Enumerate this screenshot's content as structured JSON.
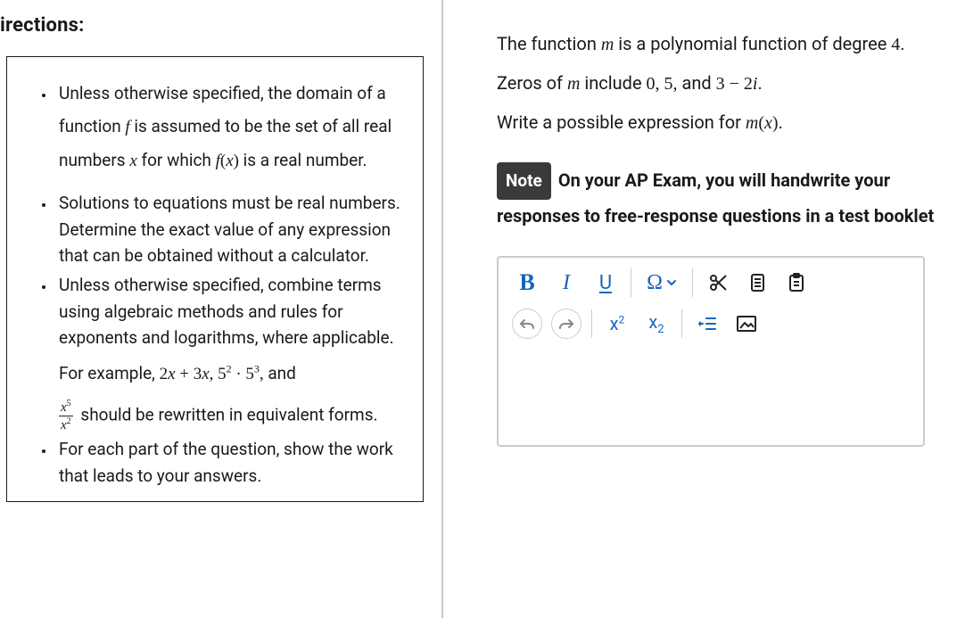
{
  "left": {
    "heading": "irections:",
    "bullets": [
      "Unless otherwise specified, the domain of a function  f  is assumed to be the set of all real numbers  x  for which  f(x)  is a real number.",
      "Solutions to equations must be real numbers. Determine the exact value of any expression that can be obtained without a calculator.",
      "Unless otherwise specified, combine terms using algebraic methods and rules for exponents and logarithms, where applicable. For example, 2x + 3x, 5² · 5³, and x⁵/x² should be rewritten in equivalent forms.",
      "For each part of the question, show the work that leads to your answers."
    ]
  },
  "right": {
    "question_line1_a": "The function ",
    "question_line1_m": "m",
    "question_line1_b": " is a polynomial function of degree ",
    "question_line1_deg": "4",
    "question_line1_c": ". Zeros of ",
    "question_line1_m2": "m",
    "question_line1_d": " include ",
    "question_zeros": "0, 5,",
    "question_line1_e": " and ",
    "question_zero_complex": "3 − 2i",
    "question_line1_f": ".",
    "question_line2_a": "Write a possible expression for ",
    "question_line2_mx": "m(x)",
    "question_line2_b": ".",
    "note_label": "Note",
    "note_text": "On your AP Exam, you will handwrite your responses to free-response questions in a test booklet"
  },
  "toolbar": {
    "bold": "B",
    "italic": "I",
    "underline": "U",
    "omega": "Ω",
    "sup": "x",
    "sup_exp": "2",
    "sub": "x",
    "sub_idx": "2"
  }
}
